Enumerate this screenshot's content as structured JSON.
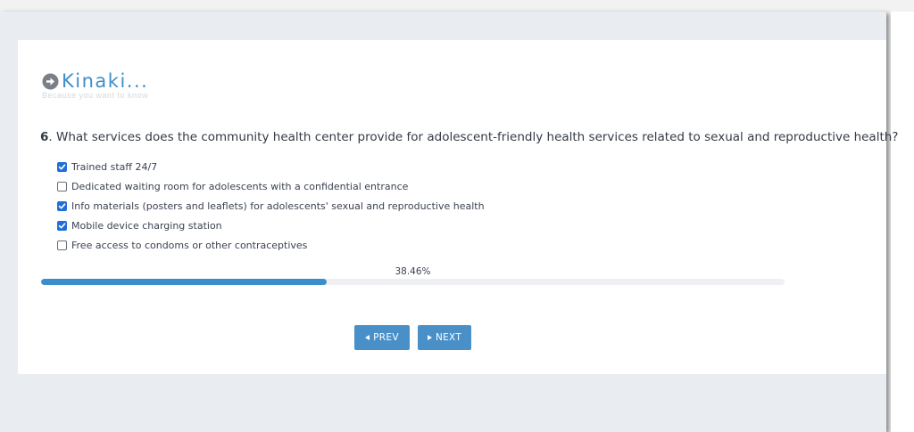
{
  "brand": {
    "name": "Kinaki...",
    "tagline": "Because you want to know",
    "color": "#3f8fc9"
  },
  "question": {
    "number": "6",
    "text": ". What services does the community health center provide for adolescent-friendly health services related to sexual and reproductive health?"
  },
  "options": [
    {
      "label": "Trained staff 24/7",
      "checked": true
    },
    {
      "label": "Dedicated waiting room for adolescents with a confidential entrance",
      "checked": false
    },
    {
      "label": "Info materials (posters and leaflets) for adolescents' sexual and reproductive health",
      "checked": true
    },
    {
      "label": "Mobile device charging station",
      "checked": true
    },
    {
      "label": "Free access to condoms or other contraceptives",
      "checked": false
    }
  ],
  "progress": {
    "label": "38.46%",
    "percent": 38.46,
    "fill_color": "#3c8dcb"
  },
  "nav": {
    "prev_label": "PREV",
    "next_label": "NEXT",
    "button_color": "#4a90c8"
  }
}
